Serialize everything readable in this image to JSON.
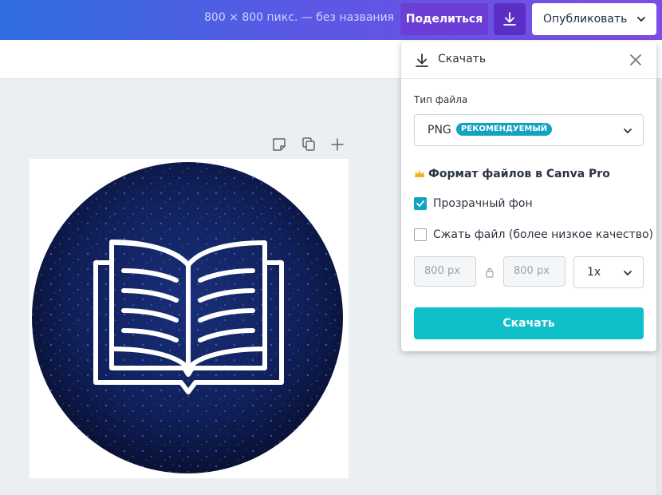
{
  "header": {
    "doc_title": "800 × 800 пикс. — без названия",
    "share_label": "Поделиться",
    "download_icon": "download-icon",
    "publish_label": "Опубликовать"
  },
  "canvas": {
    "tools": [
      "note-icon",
      "duplicate-icon",
      "add-icon"
    ],
    "artwork": "book-icon on blue glitter circle"
  },
  "download_panel": {
    "title": "Скачать",
    "file_type_label": "Тип файла",
    "file_type_value": "PNG",
    "recommended_badge": "РЕКОМЕНДУЕМЫЙ",
    "pro_label": "Формат файлов в Canva Pro",
    "transparent_bg_label": "Прозрачный фон",
    "transparent_bg_checked": true,
    "compress_label": "Сжать файл (более низкое качество)",
    "compress_checked": false,
    "width_value": "800 px",
    "height_value": "800 px",
    "scale_value": "1x",
    "download_button": "Скачать"
  },
  "colors": {
    "accent": "#0fc0c8",
    "badge": "#12a3c2",
    "share_button": "#6b3fd6"
  }
}
